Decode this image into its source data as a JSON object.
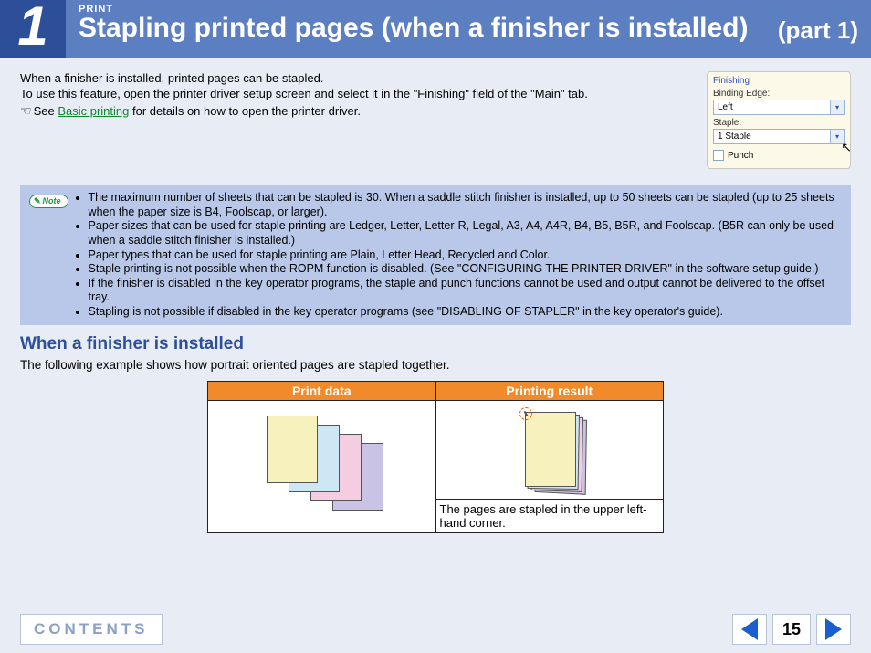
{
  "header": {
    "step": "1",
    "category": "PRINT",
    "title": "Stapling printed pages (when a finisher is installed)",
    "part": "(part 1)"
  },
  "intro": {
    "line1": "When a finisher is installed, printed pages can be stapled.",
    "line2a": "To use this feature, open the printer driver setup screen and select it in the \"Finishing\" field of the \"Main\" tab.",
    "see_prefix": "See ",
    "see_link": "Basic printing",
    "see_suffix": " for details on how to open the printer driver."
  },
  "finishing_panel": {
    "group": "Finishing",
    "binding_label": "Binding Edge:",
    "binding_value": "Left",
    "staple_label": "Staple:",
    "staple_value": "1 Staple",
    "punch_label": "Punch"
  },
  "note": {
    "badge": "Note",
    "items": [
      "The maximum number of sheets that can be stapled is 30. When a saddle stitch finisher is installed, up to 50 sheets can be stapled (up to 25 sheets when the paper size is B4, Foolscap, or larger).",
      "Paper sizes that can be used for staple printing are Ledger, Letter, Letter-R, Legal, A3, A4, A4R, B4, B5, B5R, and Foolscap. (B5R can only be used when a saddle stitch finisher is installed.)",
      "Paper types that can be used for staple printing are Plain, Letter Head, Recycled and Color.",
      "Staple printing is not possible when the ROPM function is disabled. (See \"CONFIGURING THE PRINTER DRIVER\" in the software setup guide.)",
      "If the finisher is disabled in the key operator programs, the staple and punch functions cannot be used and output cannot be delivered to the offset tray.",
      "Stapling is not possible if disabled in the key operator programs (see \"DISABLING OF STAPLER\" in the key operator's guide)."
    ]
  },
  "section": {
    "heading": "When a finisher is installed",
    "desc": "The following example shows how portrait oriented pages are stapled together.",
    "col1": "Print data",
    "col2": "Printing result",
    "caption": "The pages are stapled in the upper left-hand corner."
  },
  "footer": {
    "contents": "CONTENTS",
    "page": "15"
  }
}
